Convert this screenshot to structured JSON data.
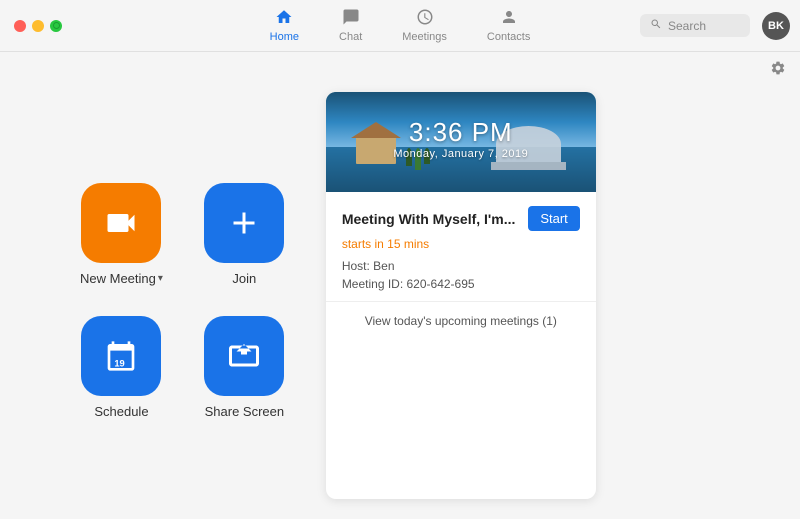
{
  "titleBar": {
    "trafficLights": [
      "red",
      "yellow",
      "green"
    ],
    "navTabs": [
      {
        "id": "home",
        "label": "Home",
        "icon": "⌂",
        "active": true
      },
      {
        "id": "chat",
        "label": "Chat",
        "icon": "💬",
        "active": false
      },
      {
        "id": "meetings",
        "label": "Meetings",
        "icon": "🕐",
        "active": false
      },
      {
        "id": "contacts",
        "label": "Contacts",
        "icon": "👤",
        "active": false
      }
    ],
    "search": {
      "placeholder": "Search",
      "icon": "search"
    },
    "avatar": {
      "initials": "BK",
      "color": "#444"
    }
  },
  "settings": {
    "icon": "⚙"
  },
  "actions": [
    {
      "id": "new-meeting",
      "label": "New Meeting",
      "hasDropdown": true,
      "icon": "📹",
      "colorClass": "btn-orange"
    },
    {
      "id": "join",
      "label": "Join",
      "hasDropdown": false,
      "icon": "+",
      "colorClass": "btn-blue"
    },
    {
      "id": "schedule",
      "label": "Schedule",
      "hasDropdown": false,
      "icon": "📅",
      "colorClass": "btn-blue"
    },
    {
      "id": "share-screen",
      "label": "Share Screen",
      "hasDropdown": false,
      "icon": "↑",
      "colorClass": "btn-blue"
    }
  ],
  "meetingCard": {
    "banner": {
      "time": "3:36 PM",
      "date": "Monday, January 7, 2019"
    },
    "title": "Meeting With Myself, I'm...",
    "startButton": "Start",
    "startsIn": "starts in 15 mins",
    "host": "Host: Ben",
    "meetingId": "Meeting ID: 620-642-695"
  },
  "viewUpcoming": "View today's upcoming meetings (1)"
}
